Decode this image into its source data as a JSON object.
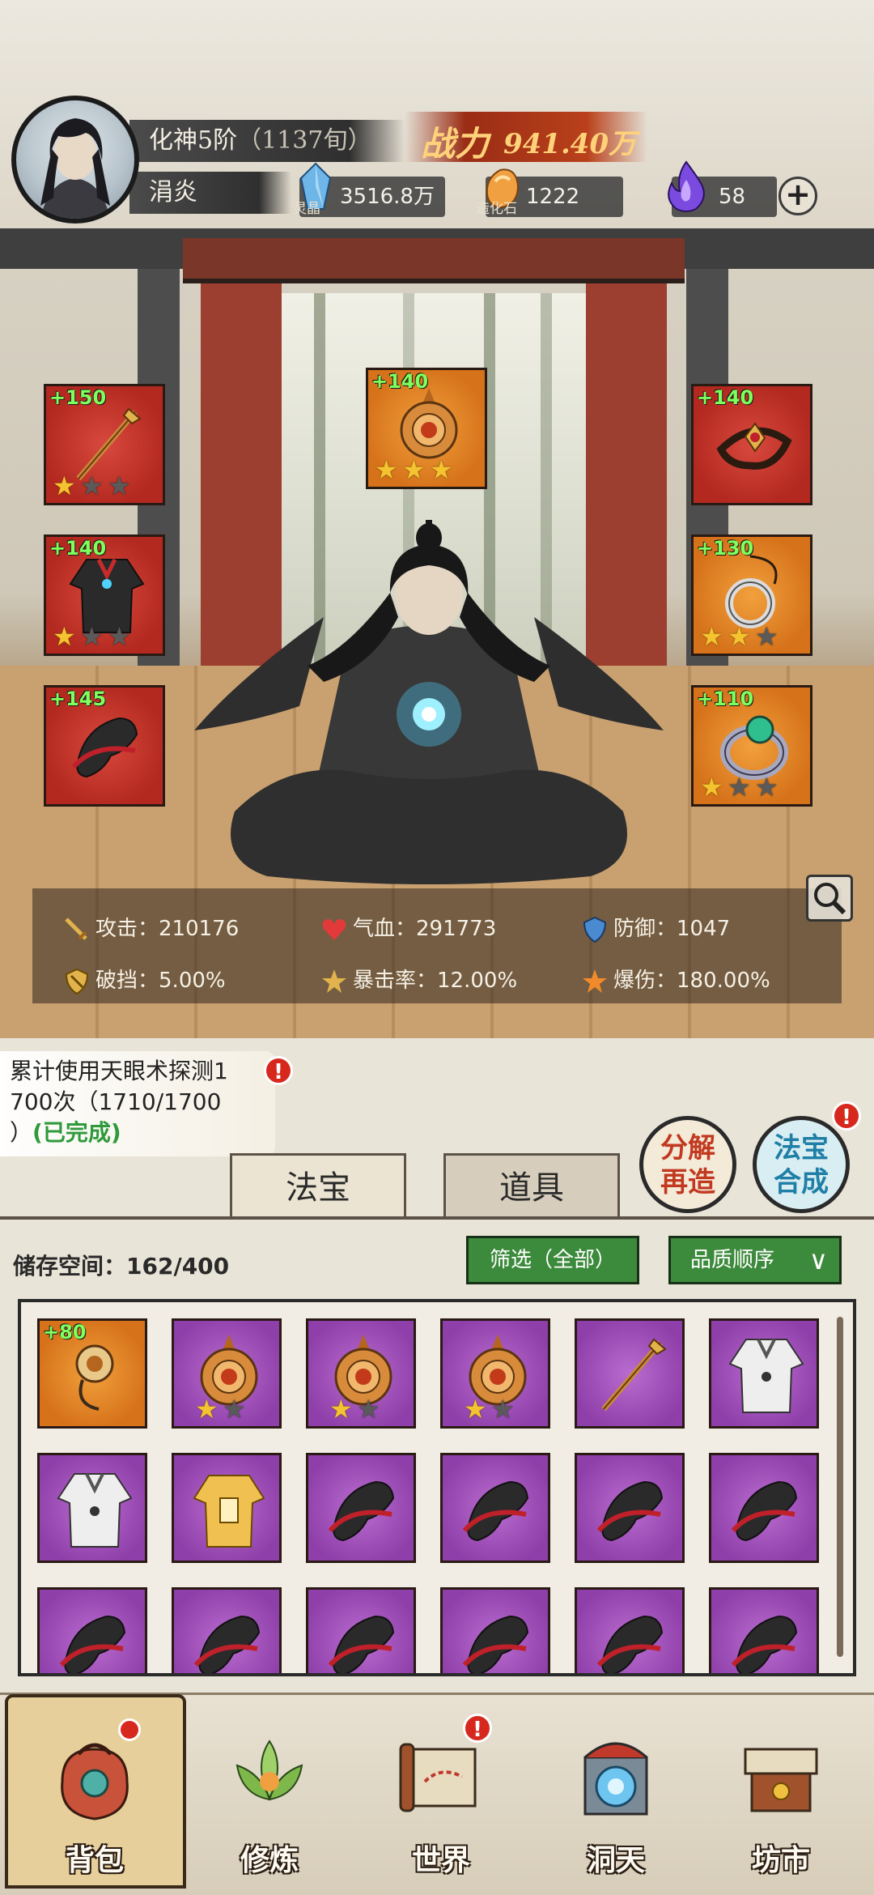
{
  "player": {
    "realm": "化神5阶",
    "age": "（1137旬）",
    "name": "涓炎",
    "power_label": "战力",
    "power_value": "941.40万"
  },
  "resources": [
    {
      "name": "灵晶",
      "value": "3516.8万",
      "icon": "crystal-icon",
      "color": "#6fb6e8"
    },
    {
      "name": "造化石",
      "value": "1222",
      "icon": "stone-icon",
      "color": "#f0a040"
    },
    {
      "name": "",
      "value": "58",
      "icon": "spirit-flame-icon",
      "color": "#7b4be0"
    }
  ],
  "equipment": {
    "left": [
      {
        "bonus": "+150",
        "stars": 1,
        "icon": "staff-icon",
        "quality": "red"
      },
      {
        "bonus": "+140",
        "stars": 1,
        "icon": "robe-icon",
        "quality": "red"
      },
      {
        "bonus": "+145",
        "stars": 0,
        "icon": "boots-icon",
        "quality": "red"
      }
    ],
    "top": {
      "bonus": "+140",
      "stars": 3,
      "icon": "orb-emblem-icon",
      "quality": "orange"
    },
    "right": [
      {
        "bonus": "+140",
        "stars": 0,
        "icon": "headband-icon",
        "quality": "red"
      },
      {
        "bonus": "+130",
        "stars": 2,
        "icon": "pendant-icon",
        "quality": "orange"
      },
      {
        "bonus": "+110",
        "stars": 1,
        "icon": "ring-icon",
        "quality": "orange"
      }
    ]
  },
  "stats": [
    {
      "label": "攻击：",
      "value": "210176",
      "icon": "sword-icon"
    },
    {
      "label": "气血：",
      "value": "291773",
      "icon": "heart-icon"
    },
    {
      "label": "防御：",
      "value": "1047",
      "icon": "shield-icon"
    },
    {
      "label": "破挡：",
      "value": "5.00%",
      "icon": "break-icon"
    },
    {
      "label": "暴击率：",
      "value": "12.00%",
      "icon": "crit-icon"
    },
    {
      "label": "爆伤：",
      "value": "180.00%",
      "icon": "crit-damage-icon"
    }
  ],
  "task": {
    "line1": "累计使用天眼术探测1",
    "line2": "700次（1710/1700",
    "line3": "）",
    "status": "(已完成)"
  },
  "buttons": {
    "decompose": "分解再造",
    "decompose_l1": "分解",
    "decompose_l2": "再造",
    "synth_l1": "法宝",
    "synth_l2": "合成",
    "alert": "!"
  },
  "tabs": [
    {
      "label": "法宝",
      "active": true
    },
    {
      "label": "道具",
      "active": false
    }
  ],
  "storage": {
    "label": "储存空间：",
    "value": "162/400",
    "filter": "筛选（全部）",
    "sort": "品质顺序"
  },
  "inventory": [
    {
      "icon": "amulet-icon",
      "quality": "orange",
      "bonus": "+80",
      "stars": -1
    },
    {
      "icon": "orb-emblem-icon",
      "quality": "purple",
      "bonus": "",
      "stars": 1
    },
    {
      "icon": "orb-emblem-icon",
      "quality": "purple",
      "bonus": "",
      "stars": 1
    },
    {
      "icon": "orb-emblem-icon",
      "quality": "purple",
      "bonus": "",
      "stars": 1
    },
    {
      "icon": "staff-icon",
      "quality": "purple",
      "bonus": "",
      "stars": -1
    },
    {
      "icon": "white-robe-icon",
      "quality": "purple",
      "bonus": "",
      "stars": -1
    },
    {
      "icon": "white-robe-icon",
      "quality": "purple",
      "bonus": "",
      "stars": -1
    },
    {
      "icon": "gold-armor-icon",
      "quality": "purple",
      "bonus": "",
      "stars": -1
    },
    {
      "icon": "boots-icon",
      "quality": "purple",
      "bonus": "",
      "stars": -1
    },
    {
      "icon": "boots-icon",
      "quality": "purple",
      "bonus": "",
      "stars": -1
    },
    {
      "icon": "boots-icon",
      "quality": "purple",
      "bonus": "",
      "stars": -1
    },
    {
      "icon": "boots-icon",
      "quality": "purple",
      "bonus": "",
      "stars": -1
    },
    {
      "icon": "boots-icon",
      "quality": "purple",
      "bonus": "",
      "stars": -1
    },
    {
      "icon": "boots-icon",
      "quality": "purple",
      "bonus": "",
      "stars": -1
    },
    {
      "icon": "boots-icon",
      "quality": "purple",
      "bonus": "",
      "stars": -1
    },
    {
      "icon": "boots-icon",
      "quality": "purple",
      "bonus": "",
      "stars": -1
    },
    {
      "icon": "boots-icon",
      "quality": "purple",
      "bonus": "",
      "stars": -1
    },
    {
      "icon": "boots-icon",
      "quality": "purple",
      "bonus": "",
      "stars": -1
    }
  ],
  "nav": [
    {
      "label": "背包",
      "icon": "bag-icon",
      "active": true,
      "badge": "dot"
    },
    {
      "label": "修炼",
      "icon": "lotus-icon",
      "active": false,
      "badge": ""
    },
    {
      "label": "世界",
      "icon": "scroll-map-icon",
      "active": false,
      "badge": "!"
    },
    {
      "label": "洞天",
      "icon": "portal-icon",
      "active": false,
      "badge": ""
    },
    {
      "label": "坊市",
      "icon": "market-icon",
      "active": false,
      "badge": ""
    }
  ],
  "colors": {
    "red_quality": "#c0342a",
    "orange_quality": "#e08a2a",
    "purple_quality": "#9a4cb8",
    "bonus_green": "#7fff5c",
    "green_button": "#3c8a3c"
  }
}
